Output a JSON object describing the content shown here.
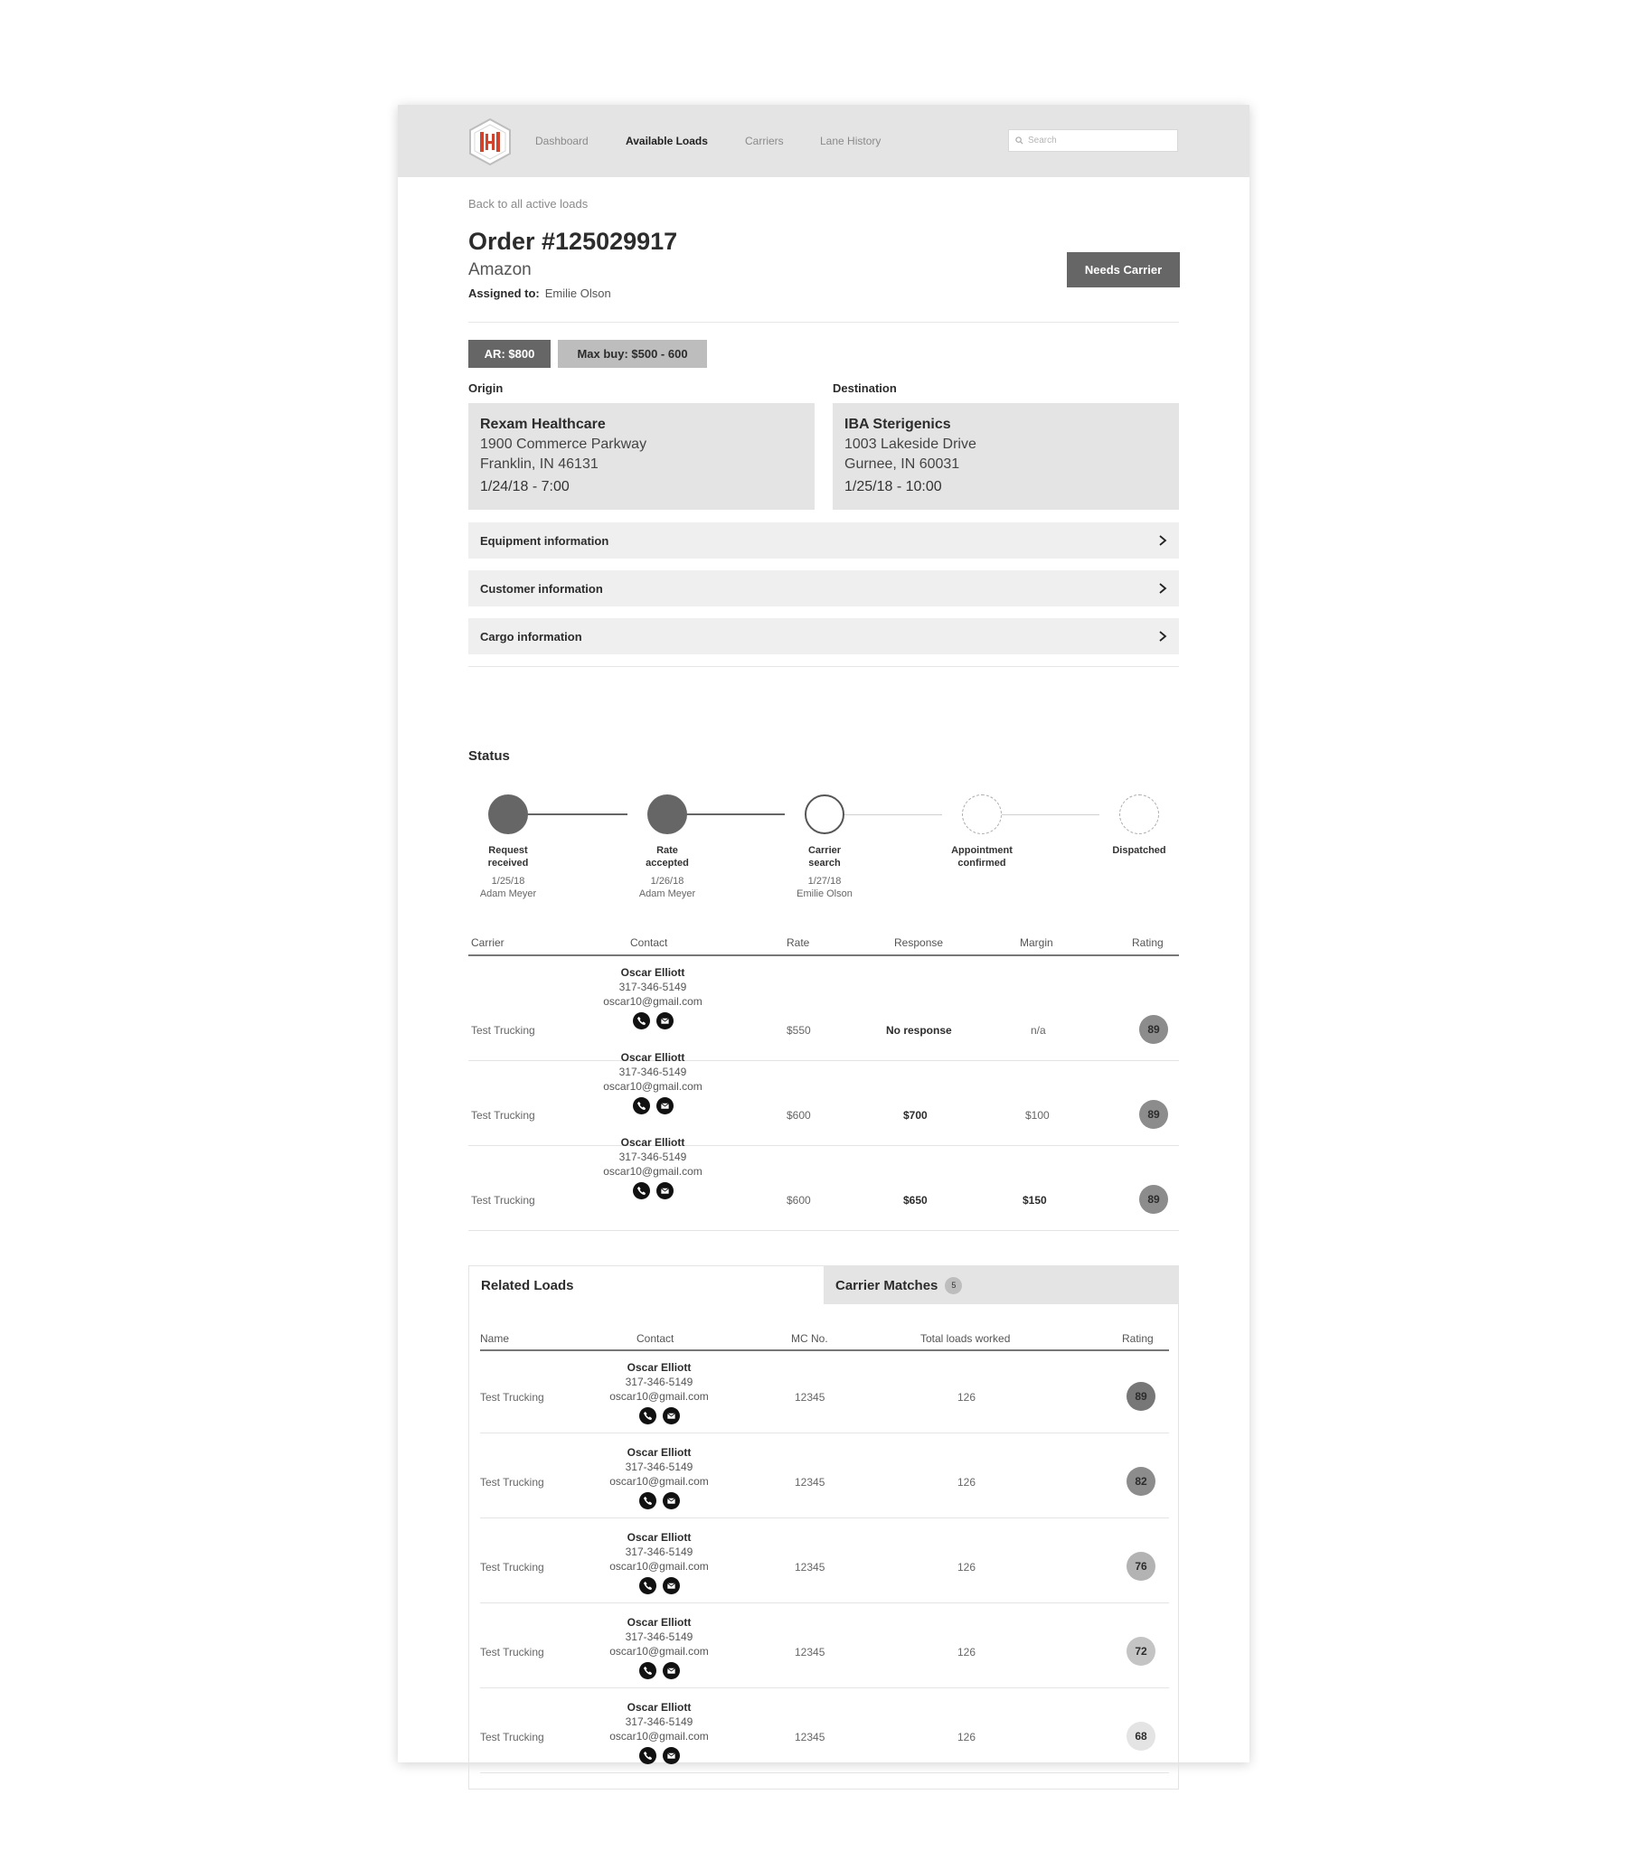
{
  "nav": {
    "items": [
      {
        "label": "Dashboard"
      },
      {
        "label": "Available Loads"
      },
      {
        "label": "Carriers"
      },
      {
        "label": "Lane History"
      }
    ],
    "search_placeholder": "Search"
  },
  "colors": {
    "logo_red": "#d0432d",
    "dark_gray": "#666666",
    "light_gray": "#e4e4e4"
  },
  "header": {
    "back_link": "Back to all active loads",
    "order_title": "Order #125029917",
    "customer": "Amazon",
    "assigned_label": "Assigned to:",
    "assigned_to": "Emilie Olson",
    "status_button": "Needs Carrier"
  },
  "tags": {
    "ar": "AR: $800",
    "max_buy": "Max buy: $500 - 600"
  },
  "origin": {
    "label": "Origin",
    "name": "Rexam Healthcare",
    "address1": "1900 Commerce Parkway",
    "address2": "Franklin, IN 46131",
    "time": "1/24/18 - 7:00"
  },
  "destination": {
    "label": "Destination",
    "name": "IBA Sterigenics",
    "address1": "1003 Lakeside Drive",
    "address2": "Gurnee, IN 60031",
    "time": "1/25/18 - 10:00"
  },
  "accordions": [
    {
      "label": "Equipment information",
      "icon": "chevron-right-icon"
    },
    {
      "label": "Customer information",
      "icon": "chevron-right-icon"
    },
    {
      "label": "Cargo information",
      "icon": "chevron-right-icon"
    }
  ],
  "status": {
    "title": "Status",
    "steps": [
      {
        "label1": "Request",
        "label2": "received",
        "date": "1/25/18",
        "person": "Adam Meyer",
        "state": "complete"
      },
      {
        "label1": "Rate",
        "label2": "accepted",
        "date": "1/26/18",
        "person": "Adam Meyer",
        "state": "complete"
      },
      {
        "label1": "Carrier",
        "label2": "search",
        "date": "1/27/18",
        "person": "Emilie Olson",
        "state": "current"
      },
      {
        "label1": "Appointment",
        "label2": "confirmed",
        "date": "",
        "person": "",
        "state": "pending"
      },
      {
        "label1": "Dispatched",
        "label2": "",
        "date": "",
        "person": "",
        "state": "pending"
      }
    ]
  },
  "carrier_table": {
    "headers": [
      "Carrier",
      "Contact",
      "Rate",
      "Response",
      "Margin",
      "Rating"
    ],
    "rows": [
      {
        "carrier": "Test Trucking",
        "contact_name": "Oscar Elliott",
        "phone": "317-346-5149",
        "email": "oscar10@gmail.com",
        "rate": "$550",
        "response": "No response",
        "margin": "n/a",
        "rating": "89"
      },
      {
        "carrier": "Test Trucking",
        "contact_name": "Oscar Elliott",
        "phone": "317-346-5149",
        "email": "oscar10@gmail.com",
        "rate": "$600",
        "response": "$700",
        "margin": "$100",
        "rating": "89"
      },
      {
        "carrier": "Test Trucking",
        "contact_name": "Oscar Elliott",
        "phone": "317-346-5149",
        "email": "oscar10@gmail.com",
        "rate": "$600",
        "response": "$650",
        "margin": "$150",
        "rating": "89"
      }
    ]
  },
  "tabs": {
    "related": "Related Loads",
    "matches": "Carrier Matches",
    "matches_count": "5"
  },
  "matches_table": {
    "headers": [
      "Name",
      "Contact",
      "MC No.",
      "Total loads worked",
      "Rating"
    ],
    "rows": [
      {
        "name": "Test Trucking",
        "contact_name": "Oscar Elliott",
        "phone": "317-346-5149",
        "email": "oscar10@gmail.com",
        "mc": "12345",
        "loads": "126",
        "rating": "89"
      },
      {
        "name": "Test Trucking",
        "contact_name": "Oscar Elliott",
        "phone": "317-346-5149",
        "email": "oscar10@gmail.com",
        "mc": "12345",
        "loads": "126",
        "rating": "82"
      },
      {
        "name": "Test Trucking",
        "contact_name": "Oscar Elliott",
        "phone": "317-346-5149",
        "email": "oscar10@gmail.com",
        "mc": "12345",
        "loads": "126",
        "rating": "76"
      },
      {
        "name": "Test Trucking",
        "contact_name": "Oscar Elliott",
        "phone": "317-346-5149",
        "email": "oscar10@gmail.com",
        "mc": "12345",
        "loads": "126",
        "rating": "72"
      },
      {
        "name": "Test Trucking",
        "contact_name": "Oscar Elliott",
        "phone": "317-346-5149",
        "email": "oscar10@gmail.com",
        "mc": "12345",
        "loads": "126",
        "rating": "68"
      }
    ]
  }
}
